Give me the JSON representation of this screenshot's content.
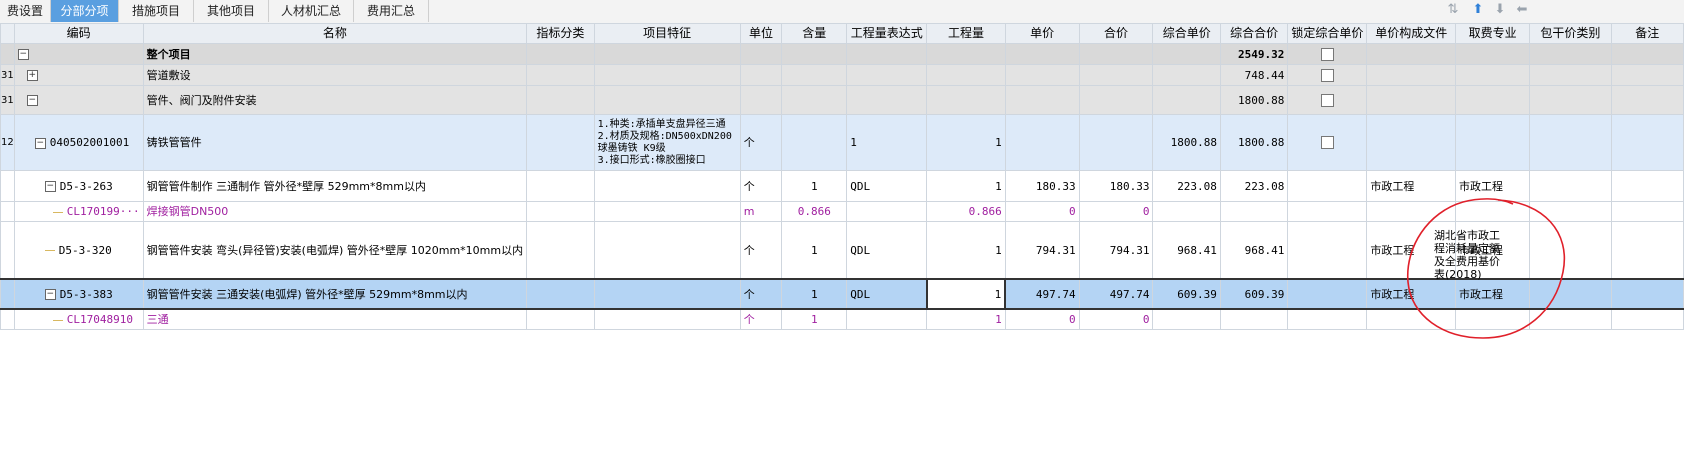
{
  "tabs": [
    {
      "label": "费设置"
    },
    {
      "label": "分部分项"
    },
    {
      "label": "措施项目"
    },
    {
      "label": "其他项目"
    },
    {
      "label": "人材机汇总"
    },
    {
      "label": "费用汇总"
    }
  ],
  "toolbar": {
    "icons": [
      "sort-icon",
      "arrow-up-icon",
      "arrow-down-icon",
      "arrow-left-icon"
    ]
  },
  "columns": [
    "编码",
    "名称",
    "指标分类",
    "项目特征",
    "单位",
    "含量",
    "工程量表达式",
    "工程量",
    "单价",
    "合价",
    "综合单价",
    "综合合价",
    "锁定综合单价",
    "单价构成文件",
    "取费专业",
    "包干价类别",
    "备注"
  ],
  "rows": [
    {
      "prefix": "",
      "code": "",
      "name": "整个项目",
      "total": "2549.32"
    },
    {
      "prefix": "31",
      "code": "",
      "name": "管道敷设",
      "total": "748.44"
    },
    {
      "prefix": "31",
      "code": "",
      "name": "管件、阀门及附件安装",
      "total": "1800.88"
    },
    {
      "prefix": "12",
      "code": "040502001001",
      "name": "铸铁管管件",
      "feature": "1.种类:承插单支盘异径三通\n2.材质及规格:DN500xDN200球墨铸铁 K9级\n3.接口形式:橡胶圈接口",
      "unit": "个",
      "expr": "1",
      "qty": "1",
      "comp_price": "1800.88",
      "total": "1800.88"
    },
    {
      "code": "D5-3-263",
      "name": "钢管管件制作 三通制作 管外径*壁厚 529mm*8mm以内",
      "unit": "个",
      "content": "1",
      "expr": "QDL",
      "qty": "1",
      "price": "180.33",
      "amount": "180.33",
      "comp_price": "223.08",
      "total": "223.08",
      "file": "市政工程",
      "major": "市政工程"
    },
    {
      "code": "CL170199···",
      "name": "焊接钢管DN500",
      "unit": "m",
      "content": "0.866",
      "qty": "0.866",
      "price": "0",
      "amount": "0"
    },
    {
      "code": "D5-3-320",
      "name": "钢管管件安装 弯头(异径管)安装(电弧焊) 管外径*壁厚 1020mm*10mm以内",
      "unit": "个",
      "content": "1",
      "expr": "QDL",
      "qty": "1",
      "price": "794.31",
      "amount": "794.31",
      "comp_price": "968.41",
      "total": "968.41",
      "file": "市政工程",
      "major": "市政工程"
    },
    {
      "code": "D5-3-383",
      "name": "钢管管件安装 三通安装(电弧焊) 管外径*壁厚 529mm*8mm以内",
      "unit": "个",
      "content": "1",
      "expr": "QDL",
      "qty": "1",
      "price": "497.74",
      "amount": "497.74",
      "comp_price": "609.39",
      "total": "609.39",
      "file": "市政工程",
      "major": "市政工程"
    },
    {
      "code": "CL17048910",
      "name": "三通",
      "unit": "个",
      "content": "1",
      "qty": "1",
      "price": "0",
      "amount": "0"
    }
  ],
  "remark_note": "湖北省市政工程消耗量定额及全费用基价表(2018)",
  "colors": {
    "accent": "#5a9fe0",
    "selected_row": "#b4d4f4",
    "item_row": "#ddeaf9",
    "material_text": "#a020a0",
    "annotation": "#e0202a"
  }
}
